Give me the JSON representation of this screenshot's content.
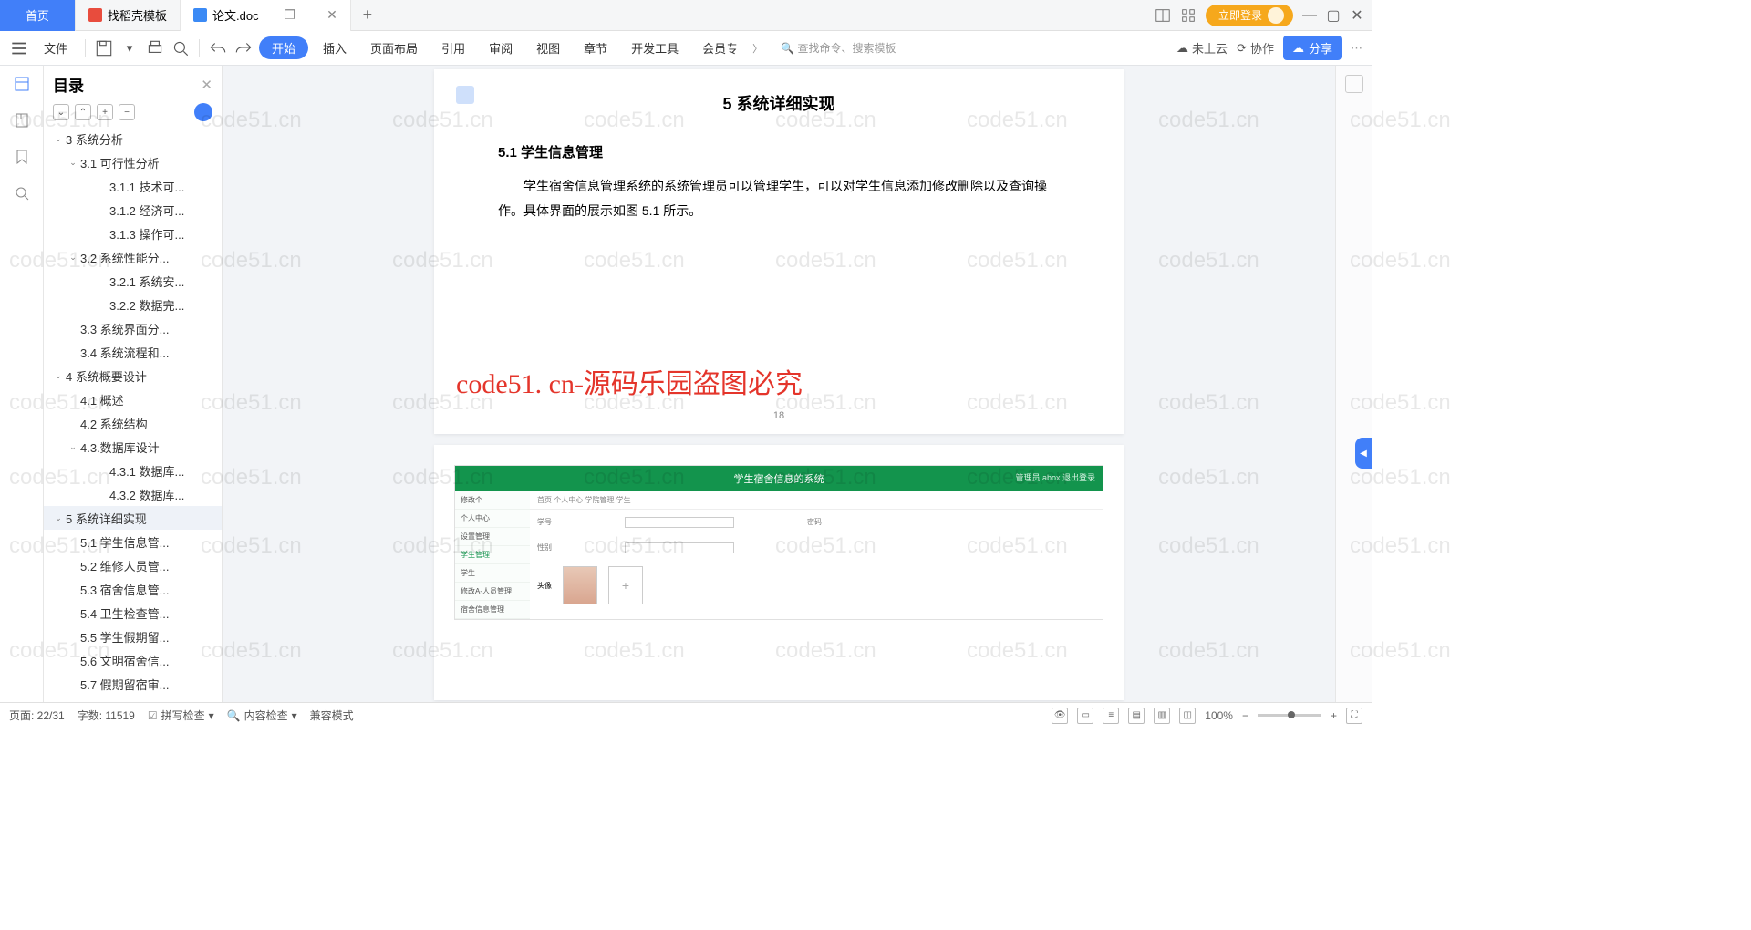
{
  "tabs": {
    "home": "首页",
    "t1": "找稻壳模板",
    "t2": "论文.doc"
  },
  "titlebar": {
    "login": "立即登录"
  },
  "menubar": {
    "file": "文件",
    "items": [
      "开始",
      "插入",
      "页面布局",
      "引用",
      "审阅",
      "视图",
      "章节",
      "开发工具",
      "会员专"
    ],
    "search": "查找命令、搜索模板",
    "cloud": "未上云",
    "collab": "协作",
    "share": "分享"
  },
  "sidebar": {
    "title": "目录",
    "items": [
      {
        "lvl": 0,
        "chev": "v",
        "txt": "3 系统分析"
      },
      {
        "lvl": 1,
        "chev": "v",
        "txt": "3.1 可行性分析"
      },
      {
        "lvl": 2,
        "chev": "",
        "txt": "3.1.1 技术可..."
      },
      {
        "lvl": 2,
        "chev": "",
        "txt": "3.1.2 经济可..."
      },
      {
        "lvl": 2,
        "chev": "",
        "txt": "3.1.3 操作可..."
      },
      {
        "lvl": 1,
        "chev": "v",
        "txt": "3.2 系统性能分..."
      },
      {
        "lvl": 2,
        "chev": "",
        "txt": "3.2.1  系统安..."
      },
      {
        "lvl": 2,
        "chev": "",
        "txt": "3.2.2  数据完..."
      },
      {
        "lvl": 1,
        "chev": "",
        "txt": "3.3 系统界面分..."
      },
      {
        "lvl": 1,
        "chev": "",
        "txt": "3.4 系统流程和..."
      },
      {
        "lvl": 0,
        "chev": "v",
        "txt": "4 系统概要设计"
      },
      {
        "lvl": 1,
        "chev": "",
        "txt": "4.1 概述"
      },
      {
        "lvl": 1,
        "chev": "",
        "txt": "4.2 系统结构"
      },
      {
        "lvl": 1,
        "chev": "v",
        "txt": "4.3.数据库设计"
      },
      {
        "lvl": 2,
        "chev": "",
        "txt": "4.3.1 数据库..."
      },
      {
        "lvl": 2,
        "chev": "",
        "txt": "4.3.2 数据库..."
      },
      {
        "lvl": 0,
        "chev": "v",
        "txt": "5 系统详细实现",
        "active": true
      },
      {
        "lvl": 1,
        "chev": "",
        "txt": "5.1  学生信息管..."
      },
      {
        "lvl": 1,
        "chev": "",
        "txt": "5.2  维修人员管..."
      },
      {
        "lvl": 1,
        "chev": "",
        "txt": "5.3  宿舍信息管..."
      },
      {
        "lvl": 1,
        "chev": "",
        "txt": "5.4  卫生检查管..."
      },
      {
        "lvl": 1,
        "chev": "",
        "txt": "5.5  学生假期留..."
      },
      {
        "lvl": 1,
        "chev": "",
        "txt": "5.6  文明宿舍信..."
      },
      {
        "lvl": 1,
        "chev": "",
        "txt": "5.7  假期留宿审..."
      }
    ]
  },
  "doc": {
    "h2": "5 系统详细实现",
    "h3": "5.1  学生信息管理",
    "p": "学生宿舍信息管理系统的系统管理员可以管理学生，可以对学生信息添加修改删除以及查询操作。具体界面的展示如图 5.1 所示。",
    "pgnum": "18",
    "redwm": "code51. cn-源码乐园盗图必究"
  },
  "sshot": {
    "title": "学生宿舍信息的系统",
    "rt": "管理员 abox  退出登录",
    "side": [
      "修改个",
      "个人中心",
      "设置管理",
      "学生管理",
      "学生",
      "修改A-人员管理",
      "宿舍信息管理"
    ],
    "bc": "首页  个人中心  学院管理  学生",
    "f1": "学号",
    "f2": "密码",
    "f3": "性别",
    "f4": "头像"
  },
  "status": {
    "page": "页面: 22/31",
    "words": "字数: 11519",
    "spell": "拼写检查",
    "content": "内容检查",
    "compat": "兼容模式",
    "zoom": "100%"
  },
  "wm": "code51.cn"
}
